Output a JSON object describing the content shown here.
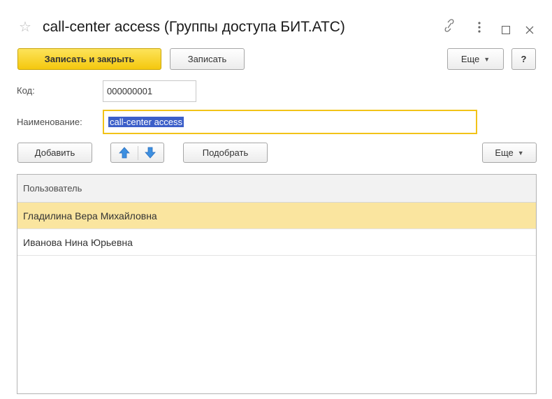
{
  "window": {
    "title": "call-center access (Группы доступа БИТ.АТС)",
    "icons": [
      "star-icon",
      "link-icon",
      "more-vertical-icon",
      "maximize-icon",
      "close-icon"
    ]
  },
  "toolbar": {
    "save_close_label": "Записать и закрыть",
    "save_label": "Записать",
    "more_label": "Еще",
    "help_label": "?"
  },
  "form": {
    "code_label": "Код:",
    "code_value": "000000001",
    "name_label": "Наименование:",
    "name_value": "call-center access"
  },
  "table_toolbar": {
    "add_label": "Добавить",
    "pick_label": "Подобрать",
    "more_label": "Еще",
    "move_up_icon": "arrow-up-icon",
    "move_down_icon": "arrow-down-icon"
  },
  "table": {
    "columns": [
      "Пользователь"
    ],
    "rows": [
      "Гладилина Вера Михайловна",
      "Иванова Нина Юрьевна"
    ],
    "selected_row": 0
  },
  "colors": {
    "primary_button": "#f4c80e",
    "selected_row": "#fae59f",
    "focus_border": "#f2c318",
    "text_selection": "#3c5fc9",
    "arrow_icon": "#3d8fe0"
  }
}
